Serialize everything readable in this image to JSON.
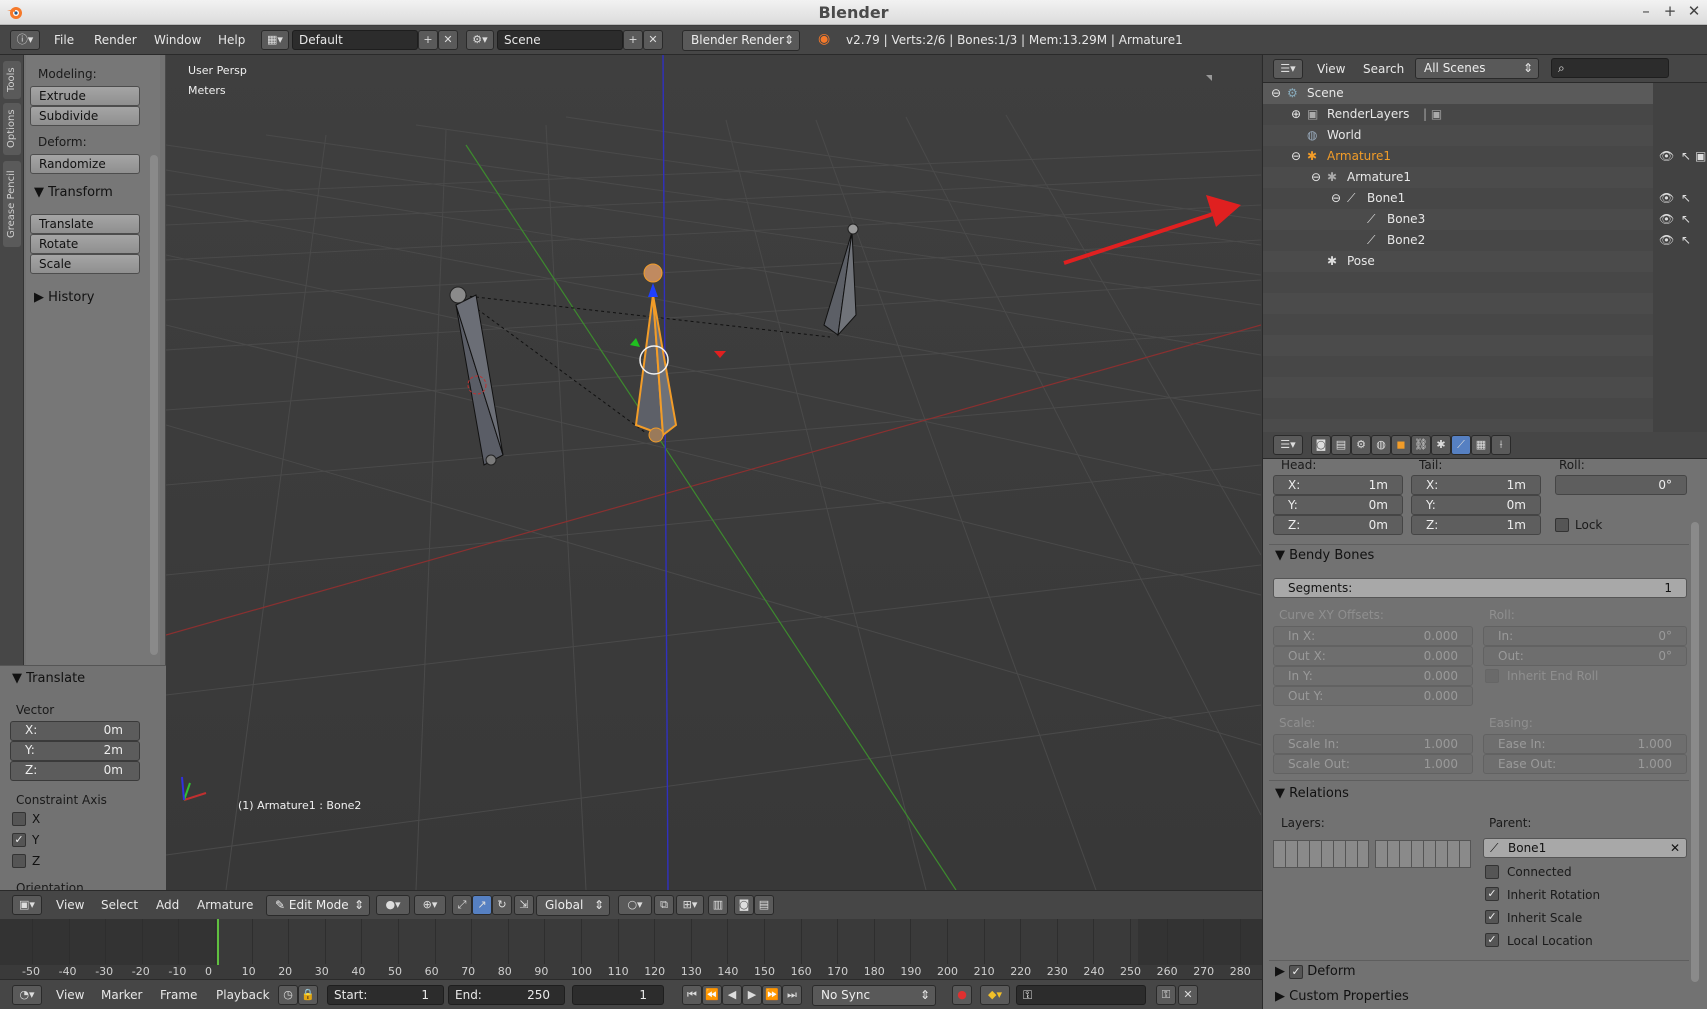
{
  "window": {
    "title": "Blender"
  },
  "infobar": {
    "menus": [
      "File",
      "Render",
      "Window",
      "Help"
    ],
    "layout": "Default",
    "scene": "Scene",
    "engine": "Blender Render",
    "stats": "v2.79 | Verts:2/6 | Bones:1/3 | Mem:13.29M | Armature1"
  },
  "toolstrip": {
    "tabs": [
      "Tools",
      "Options",
      "Grease Pencil"
    ]
  },
  "toolshelf": {
    "modeling_label": "Modeling:",
    "extrude": "Extrude",
    "subdivide": "Subdivide",
    "deform_label": "Deform:",
    "randomize": "Randomize",
    "transform_header": "Transform",
    "translate": "Translate",
    "rotate": "Rotate",
    "scale": "Scale",
    "history_header": "History"
  },
  "operator": {
    "header": "Translate",
    "vector_label": "Vector",
    "x_label": "X:",
    "x": "0m",
    "y_label": "Y:",
    "y": "2m",
    "z_label": "Z:",
    "z": "0m",
    "constraint_label": "Constraint Axis",
    "cx": "X",
    "cy": "Y",
    "cz": "Z",
    "orientation": "Orientation"
  },
  "viewport": {
    "view_name": "User Persp",
    "units": "Meters",
    "object_info": "(1) Armature1 : Bone2"
  },
  "vp_header": {
    "menus": [
      "View",
      "Select",
      "Add",
      "Armature"
    ],
    "mode": "Edit Mode",
    "orientation": "Global"
  },
  "timeline": {
    "ticks": [
      "-50",
      "-40",
      "-30",
      "-20",
      "-10",
      "0",
      "10",
      "20",
      "30",
      "40",
      "50",
      "60",
      "70",
      "80",
      "90",
      "100",
      "110",
      "120",
      "130",
      "140",
      "150",
      "160",
      "170",
      "180",
      "190",
      "200",
      "210",
      "220",
      "230",
      "240",
      "250",
      "260",
      "270",
      "280"
    ]
  },
  "tl_footer": {
    "menus": [
      "View",
      "Marker",
      "Frame",
      "Playback"
    ],
    "start_label": "Start:",
    "start": "1",
    "end_label": "End:",
    "end": "250",
    "current": "1",
    "sync": "No Sync"
  },
  "outliner": {
    "menus": [
      "View",
      "Search"
    ],
    "filter": "All Scenes",
    "items": [
      "Scene",
      "RenderLayers",
      "World",
      "Armature1",
      "Armature1",
      "Bone1",
      "Bone3",
      "Bone2",
      "Pose"
    ]
  },
  "props": {
    "head_label": "Head:",
    "tail_label": "Tail:",
    "roll_label": "Roll:",
    "head": {
      "x": "1m",
      "y": "0m",
      "z": "0m"
    },
    "tail": {
      "x": "1m",
      "y": "0m",
      "z": "1m"
    },
    "roll": "0°",
    "lock": "Lock",
    "axis_x": "X:",
    "axis_y": "Y:",
    "axis_z": "Z:",
    "bendy_header": "Bendy Bones",
    "segments_label": "Segments:",
    "segments": "1",
    "curve_label": "Curve XY Offsets:",
    "in_x_label": "In X:",
    "in_x": "0.000",
    "out_x_label": "Out X:",
    "out_x": "0.000",
    "in_y_label": "In Y:",
    "in_y": "0.000",
    "out_y_label": "Out Y:",
    "out_y": "0.000",
    "roll2_label": "Roll:",
    "roll_in_label": "In:",
    "roll_in": "0°",
    "roll_out_label": "Out:",
    "roll_out": "0°",
    "inherit_end_roll": "Inherit End Roll",
    "scale_label": "Scale:",
    "scale_in_label": "Scale In:",
    "scale_in": "1.000",
    "scale_out_label": "Scale Out:",
    "scale_out": "1.000",
    "easing_label": "Easing:",
    "ease_in_label": "Ease In:",
    "ease_in": "1.000",
    "ease_out_label": "Ease Out:",
    "ease_out": "1.000",
    "relations_header": "Relations",
    "layers_label": "Layers:",
    "parent_label": "Parent:",
    "parent": "Bone1",
    "connected": "Connected",
    "inherit_rotation": "Inherit Rotation",
    "inherit_scale": "Inherit Scale",
    "local_location": "Local Location",
    "deform_header": "Deform",
    "custom_header": "Custom Properties"
  },
  "colors": {
    "selected_bone": "#f29c28",
    "annotation_arrow": "#e02020",
    "x_axis": "#b03030",
    "y_axis": "#3d8a2e",
    "z_axis": "#3030c0"
  }
}
